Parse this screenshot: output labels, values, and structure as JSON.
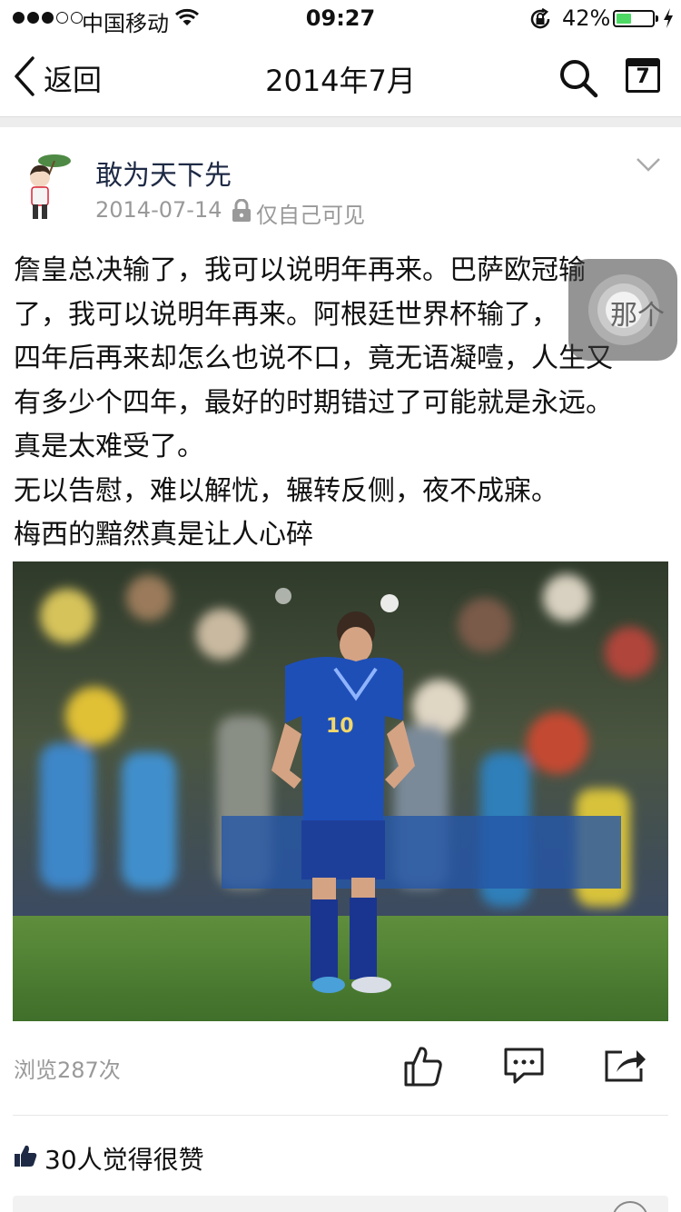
{
  "status_bar": {
    "carrier": "中国移动",
    "time": "09:27",
    "battery_percent": "42%",
    "battery_level": 0.42
  },
  "nav": {
    "back_label": "返回",
    "title": "2014年7月",
    "calendar_day": "7"
  },
  "post": {
    "author": "敢为天下先",
    "date": "2014-07-14",
    "privacy": "仅自己可见",
    "lines": [
      "詹皇总决输了，我可以说明年再来。巴萨欧冠输",
      "了，我可以说明年再来。阿根廷世界杯输了，",
      "四年后再来却怎么也说不口，竟无语凝噎，人生又",
      "有多少个四年，最好的时期错过了可能就是永远。",
      "真是太难受了。",
      "无以告慰，难以解忧，辗转反侧，夜不成寐。",
      "梅西的黯然真是让人心碎"
    ],
    "jersey_number": "10",
    "views": "浏览287次",
    "likes": "30人觉得很赞"
  },
  "assistive_touch": {
    "overlay_text": "那个"
  },
  "colors": {
    "accent_battery": "#4cd964",
    "author": "#1e2a45",
    "muted": "#999999"
  },
  "icons": [
    "back-chevron-icon",
    "search-icon",
    "calendar-icon",
    "lock-icon",
    "chevron-down-icon",
    "thumbs-up-icon",
    "comment-icon",
    "share-icon"
  ]
}
